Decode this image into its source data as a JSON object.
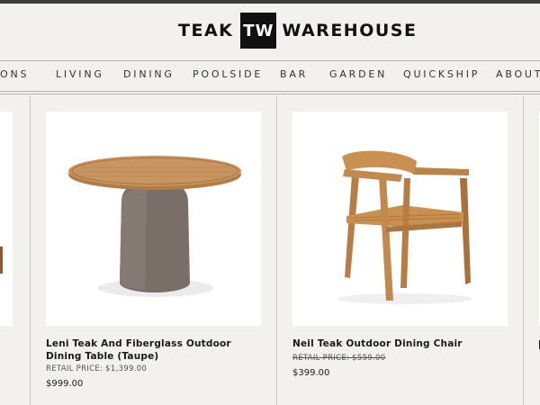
{
  "brand": {
    "left": "TEAK",
    "mark": "TW",
    "right": "WAREHOUSE"
  },
  "nav": [
    "IONS",
    "LIVING",
    "DINING",
    "POOLSIDE",
    "BAR",
    "GARDEN",
    "QUICKSHIP",
    "ABOUT"
  ],
  "products": [
    {
      "name": "Leni Teak And Fiberglass Outdoor Dining Table (Taupe)",
      "retail": "RETAIL PRICE: $1,399.00",
      "price": "$999.00"
    },
    {
      "name": "Neil Teak Outdoor Dining Chair",
      "retail": "RETAIL PRICE: $559.00",
      "price": "$399.00"
    }
  ],
  "colors": {
    "background": "#f2f1ee",
    "logo_box": "#111111",
    "teak": "#c08a4f",
    "taupe": "#7a6e68"
  }
}
